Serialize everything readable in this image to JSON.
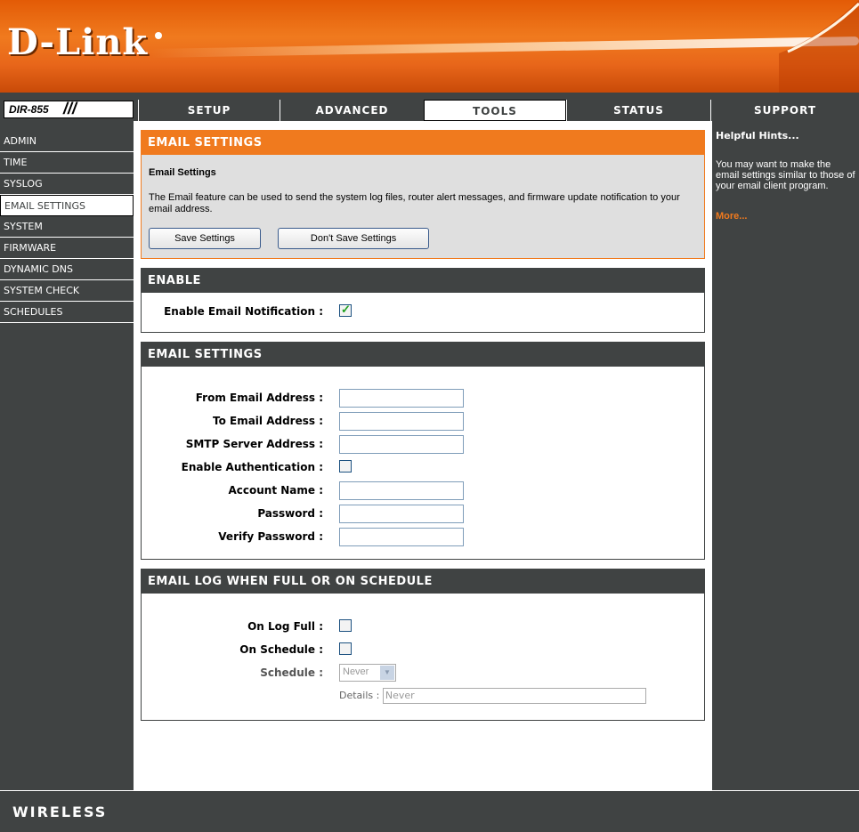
{
  "brand": {
    "logo": "D-Link",
    "model": "DIR-855",
    "footer": "WIRELESS"
  },
  "tabs": [
    {
      "label": "SETUP",
      "active": false
    },
    {
      "label": "ADVANCED",
      "active": false
    },
    {
      "label": "TOOLS",
      "active": true
    },
    {
      "label": "STATUS",
      "active": false
    },
    {
      "label": "SUPPORT",
      "active": false
    }
  ],
  "sidebar": {
    "items": [
      {
        "label": "ADMIN"
      },
      {
        "label": "TIME"
      },
      {
        "label": "SYSLOG"
      },
      {
        "label": "EMAIL SETTINGS",
        "active": true
      },
      {
        "label": "SYSTEM"
      },
      {
        "label": "FIRMWARE"
      },
      {
        "label": "DYNAMIC DNS"
      },
      {
        "label": "SYSTEM CHECK"
      },
      {
        "label": "SCHEDULES"
      }
    ]
  },
  "intro": {
    "title": "EMAIL SETTINGS",
    "heading": "Email Settings",
    "description": "The Email feature can be used to send the system log files, router alert messages, and firmware update notification to your email address.",
    "save_label": "Save Settings",
    "dont_save_label": "Don't Save Settings"
  },
  "enable": {
    "title": "ENABLE",
    "notify_label": "Enable Email Notification :",
    "notify_checked": true
  },
  "email": {
    "title": "EMAIL SETTINGS",
    "from_label": "From Email Address :",
    "from_value": "",
    "to_label": "To Email Address :",
    "to_value": "",
    "smtp_label": "SMTP Server Address :",
    "smtp_value": "",
    "auth_label": "Enable Authentication :",
    "auth_checked": false,
    "account_label": "Account Name :",
    "account_value": "",
    "password_label": "Password :",
    "verify_label": "Verify Password :"
  },
  "log": {
    "title": "EMAIL LOG WHEN FULL OR ON SCHEDULE",
    "full_label": "On Log Full :",
    "schedule_label": "On Schedule :",
    "sched_select_label": "Schedule :",
    "sched_value": "Never",
    "details_label": "Details :",
    "details_value": "Never"
  },
  "help": {
    "title": "Helpful Hints...",
    "text": "You may want to make the email settings similar to those of your email client program.",
    "more": "More..."
  }
}
